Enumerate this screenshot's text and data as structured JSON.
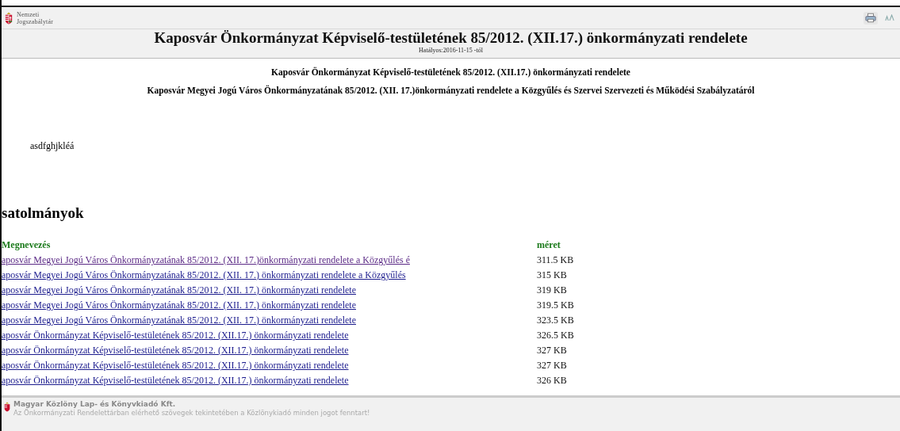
{
  "header": {
    "logo_line1": "Nemzeti",
    "logo_line2": "Jogszabálytár",
    "title": "Kaposvár Önkormányzat Képviselő-testületének 85/2012. (XII.17.) önkormányzati rendelete",
    "validity": "Hatályos:2016-11-15 -tól"
  },
  "document": {
    "heading1": "Kaposvár Önkormányzat Képviselő-testületének 85/2012. (XII.17.) önkormányzati rendelete",
    "heading2": "Kaposvár Megyei Jogú Város Önkormányzatának 85/2012. (XII. 17.)önkormányzati rendelete a Közgyűlés és Szervei Szervezeti és Működési Szabályzatáról",
    "body": "asdfghjkléá"
  },
  "attachments": {
    "title": "satolmányok",
    "columns": [
      "Megnevezés",
      "méret"
    ],
    "rows": [
      {
        "name": "aposvár Megyei Jogú Város Önkormányzatának 85/2012. (XII. 17.)önkormányzati rendelete a Közgyűlés é",
        "size": "311.5 KB",
        "visited": true
      },
      {
        "name": "aposvár Megyei Jogú Város Önkormányzatának 85/2012. (XII. 17.) önkormányzati rendelete a Közgyűlés",
        "size": "315 KB",
        "visited": false
      },
      {
        "name": "aposvár Megyei Jogú Város Önkormányzatának 85/2012. (XII. 17.) önkormányzati rendelete",
        "size": "319 KB",
        "visited": false
      },
      {
        "name": "aposvár Megyei Jogú Város Önkormányzatának 85/2012. (XII. 17.) önkormányzati rendelete",
        "size": "319.5 KB",
        "visited": false
      },
      {
        "name": "aposvár Megyei Jogú Város Önkormányzatának 85/2012. (XII. 17.) önkormányzati rendelete",
        "size": "323.5 KB",
        "visited": false
      },
      {
        "name": "aposvár Önkormányzat Képviselő-testületének 85/2012. (XII.17.) önkormányzati rendelete",
        "size": "326.5 KB",
        "visited": false
      },
      {
        "name": "aposvár Önkormányzat Képviselő-testületének 85/2012. (XII.17.) önkormányzati rendelete",
        "size": "327 KB",
        "visited": false
      },
      {
        "name": "aposvár Önkormányzat Képviselő-testületének 85/2012. (XII.17.) önkormányzati rendelete",
        "size": "327 KB",
        "visited": false
      },
      {
        "name": "aposvár Önkormányzat Képviselő-testületének 85/2012. (XII.17.) önkormányzati rendelete",
        "size": "326 KB",
        "visited": false
      }
    ]
  },
  "footer": {
    "company": "Magyar Közlöny Lap- és Könyvkiadó Kft.",
    "notice": "Az Önkormányzati Rendelettárban elérhető szövegek tekintetében a Közlönykiadó minden jogot fenntart!"
  }
}
